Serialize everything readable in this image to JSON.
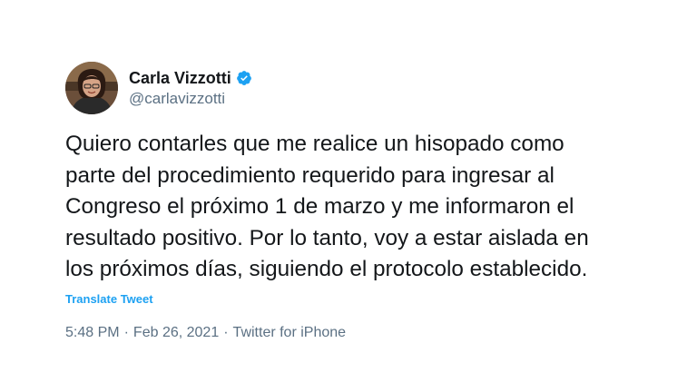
{
  "author": {
    "display_name": "Carla Vizzotti",
    "handle": "@carlavizzotti",
    "verified": true,
    "avatar_icon": "profile-photo"
  },
  "tweet": {
    "text": "Quiero contarles que me realice un hisopado como\nparte del procedimiento requerido para ingresar al\nCongreso el próximo 1 de marzo y me informaron el\nresultado positivo. Por lo tanto, voy a estar aislada en\nlos próximos días, siguiendo el protocolo establecido.",
    "translate_label": "Translate Tweet",
    "time": "5:48 PM",
    "date": "Feb 26, 2021",
    "source": "Twitter for iPhone",
    "separator": "·"
  },
  "colors": {
    "text": "#14171a",
    "muted": "#5b7083",
    "accent": "#1da1f2"
  }
}
